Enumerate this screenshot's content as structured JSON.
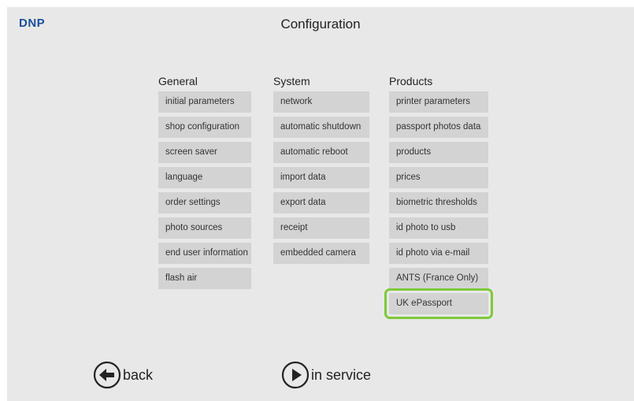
{
  "header": {
    "logo": "DNP",
    "title": "Configuration"
  },
  "columns": {
    "general": {
      "heading": "General",
      "items": [
        "initial parameters",
        "shop configuration",
        "screen saver",
        "language",
        "order settings",
        "photo sources",
        "end user information",
        "flash air"
      ]
    },
    "system": {
      "heading": "System",
      "items": [
        "network",
        "automatic shutdown",
        "automatic reboot",
        "import data",
        "export data",
        "receipt",
        "embedded camera"
      ]
    },
    "products": {
      "heading": "Products",
      "items": [
        "printer parameters",
        "passport photos data",
        "products",
        "prices",
        "biometric thresholds",
        "id photo to usb",
        "id photo via e-mail",
        "ANTS (France Only)",
        "UK ePassport"
      ],
      "highlighted_item": "UK ePassport"
    }
  },
  "footer": {
    "back_label": "back",
    "in_service_label": "in service"
  },
  "colors": {
    "background": "#e8e8e8",
    "button": "#d3d3d3",
    "highlight": "#7fc93a",
    "logo": "#1b4f9c"
  }
}
